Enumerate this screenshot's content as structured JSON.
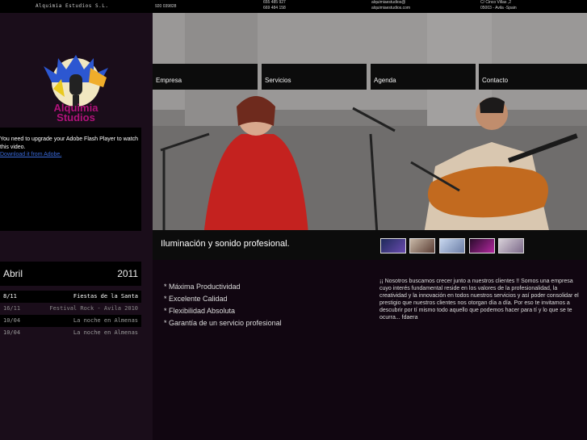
{
  "topbar": {
    "company": "Alquimia Estudios S.L.",
    "phone": "920 039828",
    "mobiles": [
      "655 485 927",
      "669 484 158"
    ],
    "emails": [
      "alquimiaestudios@",
      "alquimiaestudios.com"
    ],
    "address": [
      "C/ Cinco Villas ,2",
      "05003 - Avila -Spain"
    ]
  },
  "logo": {
    "line1": "Alquimia",
    "line2": "Studios"
  },
  "flash": {
    "message": "You need to upgrade your Adobe Flash Player to watch this video.",
    "link": "Download it from Adobe."
  },
  "calendar": {
    "month": "Abril",
    "year": "2011",
    "events": [
      {
        "date": "8/11",
        "title": "Fiestas de la Santa",
        "color": "#ffffff"
      },
      {
        "date": "16/11",
        "title": "Festival Rock - Avila 2010",
        "color": "#8b8b8b"
      },
      {
        "date": "10/04",
        "title": "La noche en Almenas",
        "color": "#9a9a9a"
      },
      {
        "date": "10/04",
        "title": "La noche en Almenas",
        "color": "#9a9a9a"
      }
    ]
  },
  "nav": {
    "items": [
      "Empresa",
      "Servicios",
      "Agenda",
      "Contacto"
    ]
  },
  "hero": {
    "tagline": "Iluminación y sonido profesional."
  },
  "features": [
    "* Máxima Productividad",
    "* Excelente Calidad",
    "* Flexibilidad Absoluta",
    "* Garantía de un servicio profesional"
  ],
  "about": "¡¡ Nosotros buscamos crecer junto a nuestros clientes !! Somos una empresa cuyo interés fundamental reside en los valores de la profesionalidad, la creatividad y la innovación en todos nuestros servicios y así poder consolidar el prestigio que nuestros clientes nos otorgan día a día. Por eso te invitamos a descubrir por tí mismo todo aquello que podemos hacer para tí y lo que se te ocurra... fdaera",
  "colors": {
    "accent": "#7a0f7a",
    "sidebar": "#1a0d1a",
    "navbar": "#0c0c0c"
  }
}
